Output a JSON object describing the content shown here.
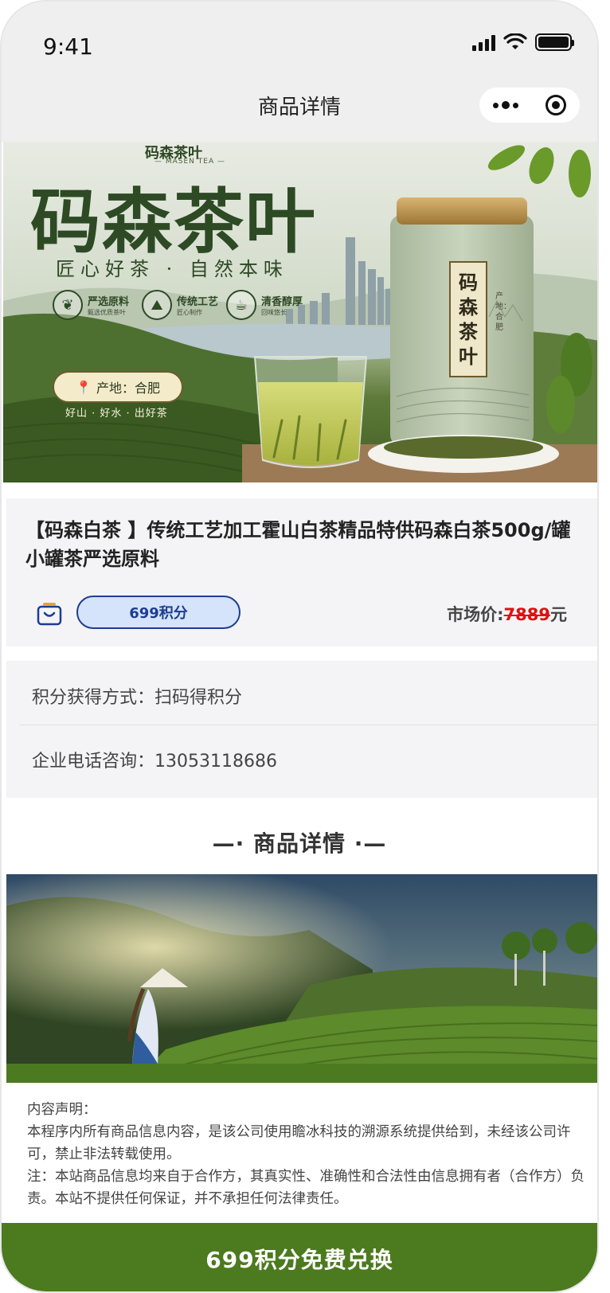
{
  "status_bar": {
    "time": "9:41"
  },
  "nav": {
    "title": "商品详情"
  },
  "hero": {
    "brand_small": "码森茶叶",
    "brand_small_sub": "— MASEN TEA —",
    "brand": "码森茶叶",
    "slogan": "匠心好茶 · 自然本味",
    "features": [
      {
        "title": "严选原料",
        "sub": "甄选优质茶叶"
      },
      {
        "title": "传统工艺",
        "sub": "匠心制作"
      },
      {
        "title": "清香醇厚",
        "sub": "回味悠长"
      }
    ],
    "origin": "产地：合肥",
    "motto": "好山 · 好水 · 出好茶",
    "can_label": [
      "码",
      "森",
      "茶",
      "叶"
    ],
    "can_side": "产地：合肥"
  },
  "product": {
    "title": "【码森白茶 】传统工艺加工霍山白茶精品特供码森白茶500g/罐小罐茶严选原料",
    "points_label": "699积分",
    "market_label": "市场价:",
    "market_price": "7889",
    "market_unit": "元"
  },
  "info": {
    "method": "积分获得方式：扫码得积分",
    "phone": "企业电话咨询：13053118686"
  },
  "section": {
    "heading": "—· 商品详情 ·—"
  },
  "disclaimer": {
    "title": "内容声明：",
    "line1": "本程序内所有商品信息内容，是该公司使用瞻冰科技的溯源系统提供给到，未经该公司许可，禁止非法转载使用。",
    "line2": "注：本站商品信息均来自于合作方，其真实性、准确性和合法性由信息拥有者（合作方）负责。本站不提供任何保证，并不承担任何法律责任。"
  },
  "cta": {
    "label": "699积分免费兑换"
  },
  "colors": {
    "primary_green": "#4c7a1f",
    "points_blue": "#1d3d8f",
    "points_bg": "#d5e3fb",
    "strike_red": "#e01010"
  }
}
